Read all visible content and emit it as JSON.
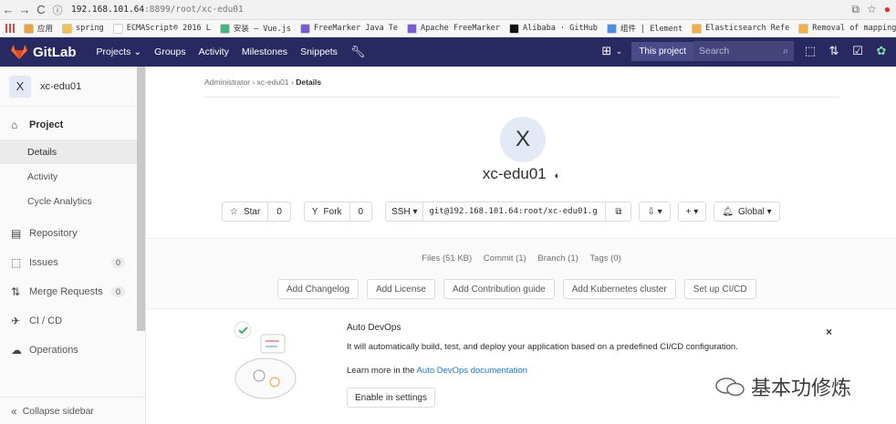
{
  "browser": {
    "url_host": "192.168.101.64",
    "url_rest": ":8899/root/xc-edu01"
  },
  "bookmarks": [
    {
      "label": "应用",
      "color": "#e8a33d"
    },
    {
      "label": "spring",
      "color": "#f0c24b"
    },
    {
      "label": "ECMAScript® 2016 L",
      "color": "#ffffff"
    },
    {
      "label": "安装 — Vue.js",
      "color": "#41b883"
    },
    {
      "label": "FreeMarker Java Te",
      "color": "#7a5bd6"
    },
    {
      "label": "Apache FreeMarker",
      "color": "#7a5bd6"
    },
    {
      "label": "Alibaba · GitHub",
      "color": "#111111"
    },
    {
      "label": "组件 | Element",
      "color": "#4a8fe7"
    },
    {
      "label": "Elasticsearch Refe",
      "color": "#f5b041"
    },
    {
      "label": "Removal of mapping",
      "color": "#f5b041"
    }
  ],
  "topnav": {
    "brand": "GitLab",
    "projects": "Projects ⌄",
    "groups": "Groups",
    "activity": "Activity",
    "milestones": "Milestones",
    "snippets": "Snippets",
    "this_project": "This project",
    "search_placeholder": "Search"
  },
  "sidebar": {
    "avatar_letter": "X",
    "project_name": "xc-edu01",
    "project_label": "Project",
    "details": "Details",
    "activity": "Activity",
    "cycle": "Cycle Analytics",
    "repository": "Repository",
    "issues": "Issues",
    "issues_count": "0",
    "merge": "Merge Requests",
    "merge_count": "0",
    "cicd": "CI / CD",
    "operations": "Operations",
    "collapse": "Collapse sidebar"
  },
  "main": {
    "crumb1": "Administrator",
    "crumb2": "xc-edu01",
    "crumb3": "Details",
    "avatar_letter": "X",
    "title": "xc-edu01",
    "star": "Star",
    "star_count": "0",
    "fork": "Fork",
    "fork_count": "0",
    "ssh": "SSH ▾",
    "ssh_url": "git@192.168.101.64:root/xc-edu01.g",
    "notify": "Global ▾",
    "stats": [
      "Files (51 KB)",
      "Commit (1)",
      "Branch (1)",
      "Tags (0)"
    ],
    "quick": [
      "Add Changelog",
      "Add License",
      "Add Contribution guide",
      "Add Kubernetes cluster",
      "Set up CI/CD"
    ]
  },
  "devops": {
    "title": "Auto DevOps",
    "text": "It will automatically build, test, and deploy your application based on a predefined CI/CD configuration.",
    "learn_prefix": "Learn more in the ",
    "learn_link": "Auto DevOps documentation",
    "button": "Enable in settings",
    "close": "×"
  },
  "watermark": "基本功修炼",
  "colors": {
    "nav": "#292961",
    "link": "#1f78d1"
  }
}
